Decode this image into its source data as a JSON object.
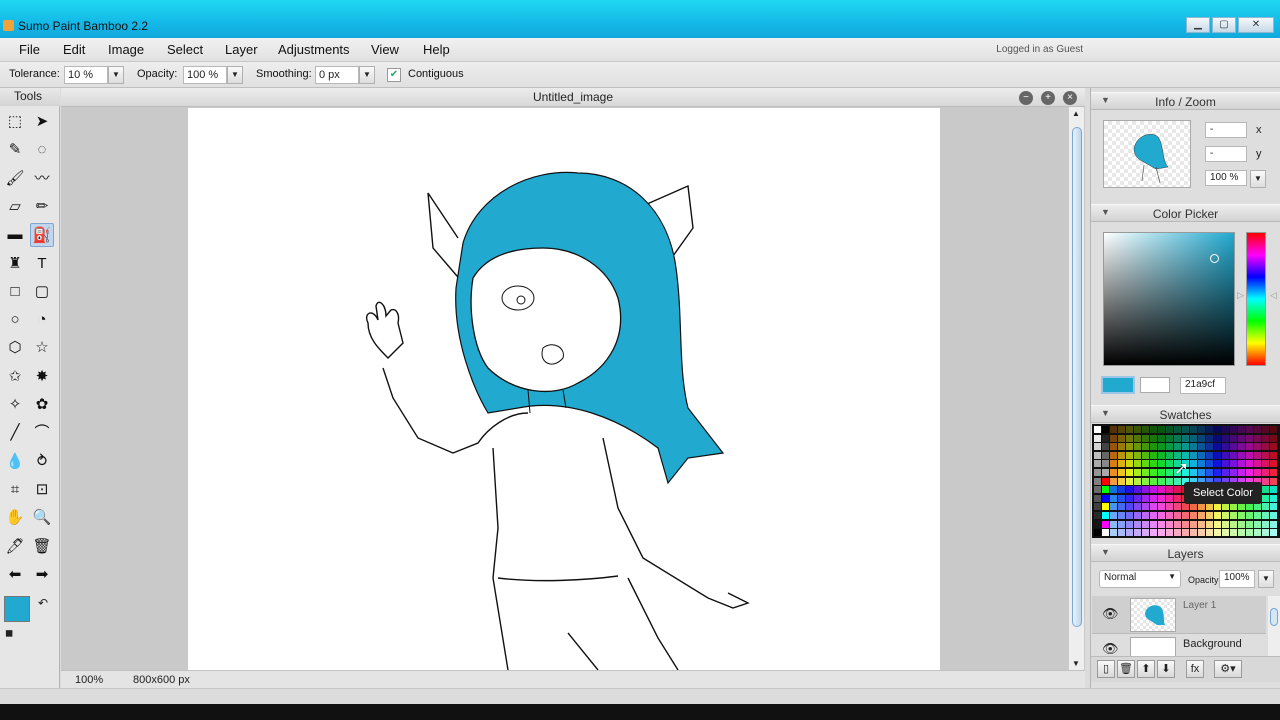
{
  "window": {
    "title": "Sumo Paint Bamboo 2.2",
    "min_label": "▁",
    "max_label": "▢",
    "close_label": "✕"
  },
  "menu": {
    "items": [
      "File",
      "Edit",
      "Image",
      "Select",
      "Layer",
      "Adjustments",
      "View",
      "Help"
    ],
    "login_status": "Logged in as Guest"
  },
  "options": {
    "tolerance_label": "Tolerance:",
    "tolerance_value": "10 %",
    "opacity_label": "Opacity:",
    "opacity_value": "100 %",
    "smoothing_label": "Smoothing:",
    "smoothing_value": "0 px",
    "contiguous_label": "Contiguous",
    "contiguous_checked": true
  },
  "tools": {
    "title": "Tools",
    "items": [
      {
        "name": "rectangle-select",
        "glyph": "⬚"
      },
      {
        "name": "move",
        "glyph": "➤"
      },
      {
        "name": "magic-wand",
        "glyph": "✎"
      },
      {
        "name": "lasso",
        "glyph": "◌"
      },
      {
        "name": "brush",
        "glyph": "🖌"
      },
      {
        "name": "smudge",
        "glyph": "〰"
      },
      {
        "name": "eraser",
        "glyph": "▱"
      },
      {
        "name": "pencil",
        "glyph": "✏"
      },
      {
        "name": "gradient",
        "glyph": "▬"
      },
      {
        "name": "bucket",
        "glyph": "⛽",
        "selected": true
      },
      {
        "name": "stamp",
        "glyph": "♜"
      },
      {
        "name": "text",
        "glyph": "T"
      },
      {
        "name": "rectangle",
        "glyph": "□"
      },
      {
        "name": "rounded-rect",
        "glyph": "▢"
      },
      {
        "name": "ellipse",
        "glyph": "○"
      },
      {
        "name": "spiral",
        "glyph": "◔"
      },
      {
        "name": "hexagon",
        "glyph": "⬡"
      },
      {
        "name": "star",
        "glyph": "☆"
      },
      {
        "name": "star-2",
        "glyph": "✩"
      },
      {
        "name": "burst",
        "glyph": "✸"
      },
      {
        "name": "star-3",
        "glyph": "✧"
      },
      {
        "name": "flower",
        "glyph": "✿"
      },
      {
        "name": "line",
        "glyph": "╱"
      },
      {
        "name": "curve",
        "glyph": "⌒"
      },
      {
        "name": "drop",
        "glyph": "💧"
      },
      {
        "name": "mixer",
        "glyph": "⥁"
      },
      {
        "name": "crop",
        "glyph": "⌗"
      },
      {
        "name": "transform",
        "glyph": "⊡"
      },
      {
        "name": "hand",
        "glyph": "✋"
      },
      {
        "name": "zoom",
        "glyph": "🔍"
      },
      {
        "name": "eyedropper",
        "glyph": "🖊"
      },
      {
        "name": "trash",
        "glyph": "🗑"
      },
      {
        "name": "undo-arrow",
        "glyph": "⬅"
      },
      {
        "name": "redo-arrow",
        "glyph": "➡"
      }
    ],
    "primary_color": "#21a9cf",
    "secondary_color": "#ffffff"
  },
  "document": {
    "title": "Untitled_image",
    "zoom": "100%",
    "size": "800x600 px"
  },
  "info_zoom": {
    "title": "Info / Zoom",
    "x_value": "-",
    "x_label": "x",
    "y_value": "-",
    "y_label": "y",
    "zoom_value": "100 %"
  },
  "color_picker": {
    "title": "Color Picker",
    "hex": "21a9cf",
    "fg_color": "#21a9cf",
    "bg_color": "#ffffff"
  },
  "swatches": {
    "title": "Swatches",
    "tooltip": "Select Color"
  },
  "layers": {
    "title": "Layers",
    "blend_mode": "Normal",
    "opacity_label": "Opacity:",
    "opacity_value": "100%",
    "items": [
      {
        "name": "Layer 1",
        "selected": true
      },
      {
        "name": "Background",
        "selected": false
      }
    ]
  }
}
